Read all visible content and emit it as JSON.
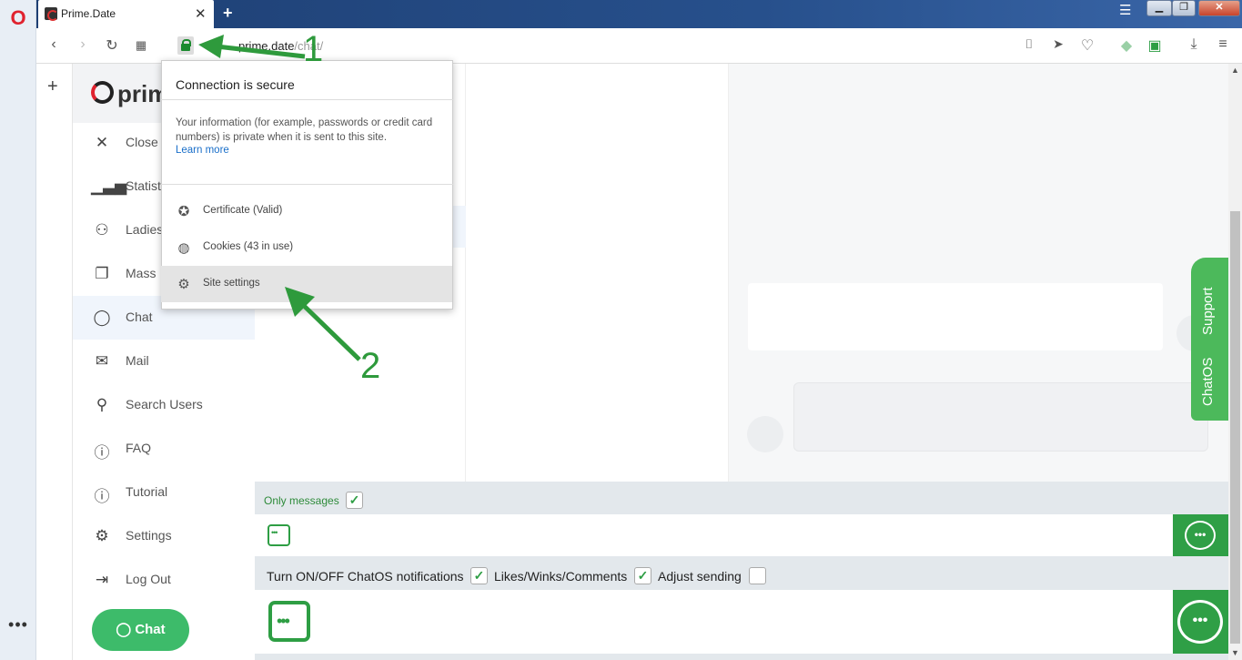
{
  "browser": {
    "tab_title": "Prime.Date",
    "url_host": "prime.date",
    "url_path": "/chat/"
  },
  "site": {
    "logo_text": "prim",
    "nav": [
      {
        "label": "Close",
        "icon": "close-icon"
      },
      {
        "label": "Statist",
        "icon": "bar-chart-icon"
      },
      {
        "label": "Ladies",
        "icon": "users-icon"
      },
      {
        "label": "Mass",
        "icon": "copy-icon"
      },
      {
        "label": "Chat",
        "icon": "chat-bubble-icon"
      },
      {
        "label": "Mail",
        "icon": "mail-icon"
      },
      {
        "label": "Search Users",
        "icon": "search-icon"
      },
      {
        "label": "FAQ",
        "icon": "info-icon"
      },
      {
        "label": "Tutorial",
        "icon": "info-icon"
      },
      {
        "label": "Settings",
        "icon": "gear-icon"
      },
      {
        "label": "Log Out",
        "icon": "logout-icon"
      }
    ],
    "chat_button": "Chat",
    "support_tab": {
      "support": "Support",
      "chatos": "ChatOS"
    }
  },
  "chatos": {
    "only_messages": "Only messages",
    "notifications_label": "Turn ON/OFF ChatOS notifications",
    "likes_label": "Likes/Winks/Comments",
    "adjust_label": "Adjust sending",
    "only_messages_checked": true,
    "notifications_checked": true,
    "likes_checked": true,
    "adjust_checked": false
  },
  "popup": {
    "title": "Connection is secure",
    "description": "Your information (for example, passwords or credit card numbers) is private when it is sent to this site.",
    "learn_more": "Learn more",
    "certificate": "Certificate (Valid)",
    "cookies": "Cookies (43 in use)",
    "site_settings": "Site settings"
  },
  "annotations": {
    "step1": "1",
    "step2": "2"
  },
  "colors": {
    "accent_green": "#2e9e44",
    "brand_red": "#e0222e",
    "tab_bar_blue": "#27508c"
  }
}
